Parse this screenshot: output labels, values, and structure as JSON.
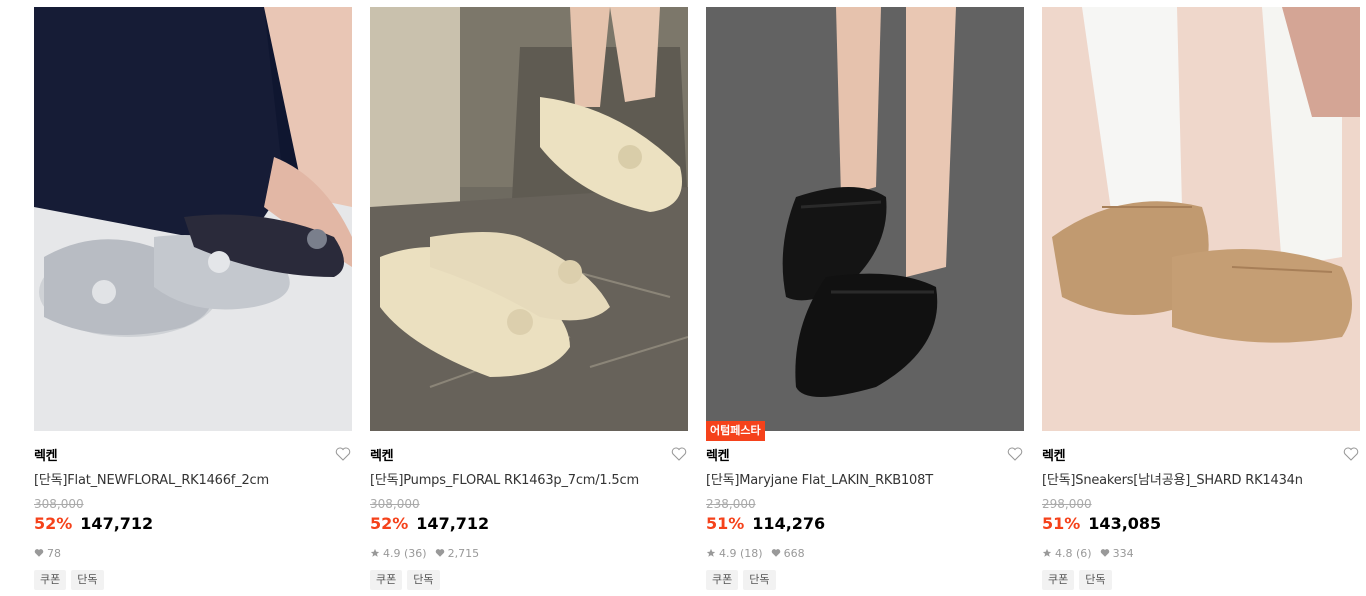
{
  "products": [
    {
      "brand": "렉켄",
      "title": "[단독]Flat_NEWFLORAL_RK1466f_2cm",
      "original_price": "308,000",
      "discount_rate": "52%",
      "price": "147,712",
      "rating": "",
      "review_count": "",
      "likes": "78",
      "badge": "",
      "tags": [
        "쿠폰",
        "단독"
      ],
      "image": "silver mesh flats with rose ornament"
    },
    {
      "brand": "렉켄",
      "title": "[단독]Pumps_FLORAL RK1463p_7cm/1.5cm",
      "original_price": "308,000",
      "discount_rate": "52%",
      "price": "147,712",
      "rating": "4.9",
      "review_count": "(36)",
      "likes": "2,715",
      "badge": "",
      "tags": [
        "쿠폰",
        "단독"
      ],
      "image": "cream slingback pumps with rose ornament"
    },
    {
      "brand": "렉켄",
      "title": "[단독]Maryjane Flat_LAKIN_RKB108T",
      "original_price": "238,000",
      "discount_rate": "51%",
      "price": "114,276",
      "rating": "4.9",
      "review_count": "(18)",
      "likes": "668",
      "badge": "어텀페스타",
      "tags": [
        "쿠폰",
        "단독"
      ],
      "image": "black mesh maryjane flats"
    },
    {
      "brand": "렉켄",
      "title": "[단독]Sneakers[남녀공용]_SHARD RK1434n",
      "original_price": "298,000",
      "discount_rate": "51%",
      "price": "143,085",
      "rating": "4.8",
      "review_count": "(6)",
      "likes": "334",
      "badge": "",
      "tags": [
        "쿠폰",
        "단독"
      ],
      "image": "tan suede sneakers with white socks"
    }
  ],
  "colors": {
    "accent": "#f5421b",
    "muted": "#999999"
  },
  "icons": {
    "like": "heart-icon",
    "rating": "star-icon",
    "likes": "small-heart-icon"
  }
}
